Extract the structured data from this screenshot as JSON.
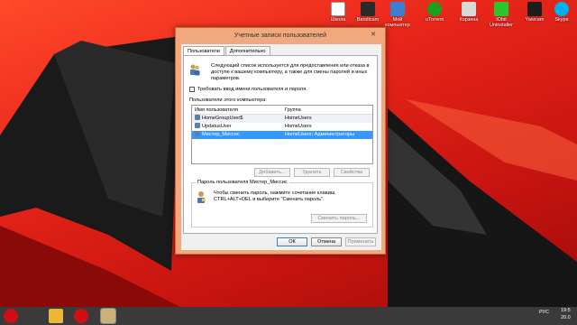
{
  "desktop_icons": [
    {
      "label": "Школа",
      "icon": "school-app-icon",
      "color": "#ffffff"
    },
    {
      "label": "Bandicam",
      "icon": "bandicam-icon",
      "color": "#2b2b2b"
    },
    {
      "label": "Мой компьютер",
      "icon": "computer-icon",
      "color": "#3b7fd1"
    },
    {
      "label": "uTorrent",
      "icon": "utorrent-icon",
      "color": "#1aa01a"
    },
    {
      "label": "Корзина",
      "icon": "recycle-bin-icon",
      "color": "#d9d9d9"
    },
    {
      "label": "IObit Uninstaller",
      "icon": "iobit-uninstaller-icon",
      "color": "#2ec42e"
    },
    {
      "label": "Yawcam",
      "icon": "webcam-icon",
      "color": "#1d1d1d"
    },
    {
      "label": "Skype",
      "icon": "skype-icon",
      "color": "#00aff0"
    }
  ],
  "dialog": {
    "title": "Учетные записи пользователей",
    "close_label": "✕",
    "tabs": [
      {
        "label": "Пользователи",
        "active": true
      },
      {
        "label": "Дополнительно",
        "active": false
      }
    ],
    "intro_text": "Следующий список используется для предоставления или отказа в доступе к вашему компьютеру, а также для смены паролей и иных параметров.",
    "require_password_label": "Требовать ввод имени пользователя и пароля.",
    "require_password_checked": false,
    "list_label": "Пользователи этого компьютера:",
    "columns": [
      "Имя пользователя",
      "Группа"
    ],
    "users": [
      {
        "name": "HomeGroupUser$",
        "group": "HomeUsers",
        "selected": false
      },
      {
        "name": "UpdatusUser",
        "group": "HomeUsers",
        "selected": false
      },
      {
        "name": "Мистер_Миссис",
        "group": "HomeUsers; Администраторы",
        "selected": true
      }
    ],
    "buttons": {
      "add": "Добавить...",
      "remove": "Удалить",
      "properties": "Свойства",
      "ok": "ОК",
      "cancel": "Отмена",
      "apply": "Применить"
    },
    "password_group": {
      "label": "Пароль пользователя Мистер_Миссис",
      "text": "Чтобы сменить пароль, нажмите сочетание клавиш CTRL+ALT+DEL и выберите \"Сменить пароль\".",
      "button": "Сменить пароль..."
    }
  },
  "taskbar": {
    "apps": [
      {
        "icon": "opera-icon",
        "color": "#cc0f16"
      },
      {
        "icon": "file-explorer-icon",
        "color": "#e8b83a"
      },
      {
        "icon": "bandicam-record-icon",
        "color": "#d01010"
      },
      {
        "icon": "user-accounts-icon",
        "color": "#c9b27a"
      }
    ],
    "language": "РУС",
    "time": "19:5",
    "date": "20.0"
  }
}
